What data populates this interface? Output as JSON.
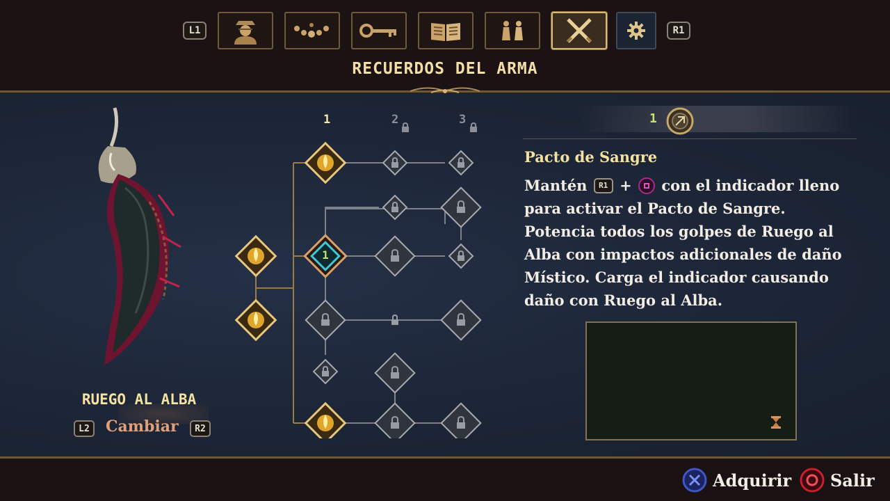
{
  "nav": {
    "prev_button": "L1",
    "next_button": "R1",
    "tabs": [
      {
        "name": "character",
        "icon": "character-portrait-icon"
      },
      {
        "name": "relics",
        "icon": "prayer-beads-icon"
      },
      {
        "name": "key-items",
        "icon": "key-icon"
      },
      {
        "name": "codex",
        "icon": "open-book-icon"
      },
      {
        "name": "figures",
        "icon": "chess-pieces-icon"
      },
      {
        "name": "weapon-memories",
        "icon": "crossed-swords-icon",
        "active": true
      },
      {
        "name": "options",
        "icon": "gear-icon"
      }
    ]
  },
  "section_title": "RECUERDOS DEL ARMA",
  "weapon": {
    "name": "RUEGO AL ALBA",
    "prev_button": "L2",
    "next_button": "R2",
    "swap_label": "Cambiar"
  },
  "tree": {
    "columns": [
      {
        "label": "1",
        "locked": false
      },
      {
        "label": "2",
        "locked": true
      },
      {
        "label": "3",
        "locked": true
      }
    ],
    "selected_node_value": "1"
  },
  "info": {
    "points": "1",
    "skill_name": "Pacto de Sangre",
    "desc_part1": "Mantén",
    "desc_button": "R1",
    "desc_plus": "+",
    "desc_part2": "con el indicador lleno para activar el Pacto de Sangre. Potencia todos los golpes de Ruego al Alba con impactos adicionales de daño Místico.  Carga el indicador causando daño con Ruego al Alba."
  },
  "footer": {
    "acquire_label": "Adquirir",
    "exit_label": "Salir"
  },
  "colors": {
    "gold": "#f3e2a2",
    "accent_green": "#c9e36a",
    "selected_ring": "#3fc7d8",
    "cross_button": "#3f56c9",
    "circle_button": "#c8202c",
    "square_button": "#e14fbd"
  }
}
